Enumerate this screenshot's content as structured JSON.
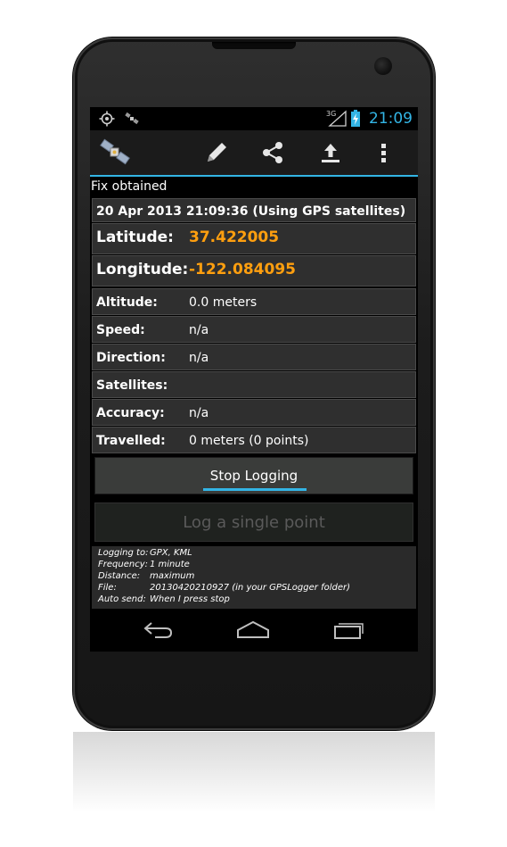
{
  "status_bar": {
    "left_icons": [
      "gps-icon",
      "satellite-icon"
    ],
    "network": "3G",
    "clock": "21:09"
  },
  "action_bar": {
    "app_icon": "satellite-app-icon",
    "actions": [
      "pencil-icon",
      "share-icon",
      "upload-icon",
      "overflow-menu-icon"
    ]
  },
  "fix_status": "Fix obtained",
  "timestamp_line": "20 Apr 2013 21:09:36   (Using GPS satellites)",
  "location": {
    "latitude_label": "Latitude:",
    "latitude_value": "37.422005",
    "longitude_label": "Longitude:",
    "longitude_value": "-122.084095"
  },
  "details": {
    "altitude_label": "Altitude:",
    "altitude_value": "0.0 meters",
    "speed_label": "Speed:",
    "speed_value": "n/a",
    "direction_label": "Direction:",
    "direction_value": "n/a",
    "satellites_label": "Satellites:",
    "satellites_value": "",
    "accuracy_label": "Accuracy:",
    "accuracy_value": "n/a",
    "travelled_label": "Travelled:",
    "travelled_value": "0  meters (0 points)"
  },
  "buttons": {
    "stop_logging": "Stop Logging",
    "log_single_point": "Log a single point"
  },
  "info": {
    "logging_to_label": "Logging to:",
    "logging_to_value": "GPX, KML",
    "frequency_label": "Frequency:",
    "frequency_value": "1 minute",
    "distance_label": "Distance:",
    "distance_value": "maximum",
    "file_label": "File:",
    "file_value": "20130420210927 (in your GPSLogger folder)",
    "auto_send_label": "Auto send:",
    "auto_send_value": "When I press stop"
  },
  "nav_bar": [
    "back-icon",
    "home-icon",
    "recent-apps-icon"
  ],
  "colors": {
    "accent": "#33b5e5",
    "coordinate_value": "#ff9f0f",
    "row_background": "#2f2f2f"
  }
}
